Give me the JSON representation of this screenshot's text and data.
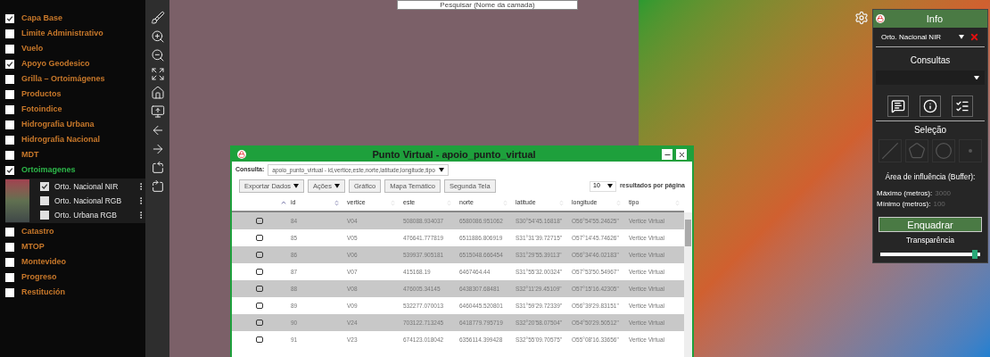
{
  "search": {
    "placeholder": "Pesquisar (Nome da camada)"
  },
  "layers": [
    {
      "label": "Capa Base",
      "checked": true,
      "expanded": false
    },
    {
      "label": "Limite Administrativo",
      "checked": false,
      "expanded": false
    },
    {
      "label": "Vuelo",
      "checked": false,
      "expanded": false
    },
    {
      "label": "Apoyo Geodesico",
      "checked": true,
      "expanded": false
    },
    {
      "label": "Grilla – Ortoimágenes",
      "checked": false,
      "expanded": false
    },
    {
      "label": "Productos",
      "checked": false,
      "expanded": false
    },
    {
      "label": "Fotoindice",
      "checked": false,
      "expanded": false
    },
    {
      "label": "Hidrografia Urbana",
      "checked": false,
      "expanded": false
    },
    {
      "label": "Hidrografia Nacional",
      "checked": false,
      "expanded": false
    },
    {
      "label": "MDT",
      "checked": false,
      "expanded": false
    },
    {
      "label": "Ortoimagenes",
      "checked": true,
      "expanded": true,
      "children": [
        {
          "label": "Orto. Nacional NIR",
          "checked": true
        },
        {
          "label": "Orto. Nacional RGB",
          "checked": false
        },
        {
          "label": "Orto. Urbana RGB",
          "checked": false
        }
      ]
    },
    {
      "label": "Catastro",
      "checked": false,
      "expanded": false
    },
    {
      "label": "MTOP",
      "checked": false,
      "expanded": false
    },
    {
      "label": "Montevideo",
      "checked": false,
      "expanded": false
    },
    {
      "label": "Progreso",
      "checked": false,
      "expanded": false
    },
    {
      "label": "Restitución",
      "checked": false,
      "expanded": false
    }
  ],
  "dialog": {
    "title": "Punto Virtual - apoio_punto_virtual",
    "query": {
      "label": "Consulta:",
      "value": "apoio_punto_virtual - id,vertice,este,norte,latitude,longitude,tipo"
    },
    "buttons": [
      {
        "label": "Exportar Dados",
        "dropdown": true
      },
      {
        "label": "Ações",
        "dropdown": true
      },
      {
        "label": "Gráfico",
        "dropdown": false
      },
      {
        "label": "Mapa Temático",
        "dropdown": false
      },
      {
        "label": "Segunda Tela",
        "dropdown": false
      }
    ],
    "page_size": {
      "value": "10",
      "label": "resultados por página"
    },
    "columns": [
      {
        "label": "id",
        "sorted": true
      },
      {
        "label": "vertice",
        "sorted": false
      },
      {
        "label": "este",
        "sorted": false
      },
      {
        "label": "norte",
        "sorted": false
      },
      {
        "label": "latitude",
        "sorted": false
      },
      {
        "label": "longitude",
        "sorted": false
      },
      {
        "label": "tipo",
        "sorted": false
      }
    ],
    "rows": [
      {
        "selected": false,
        "cells": [
          "84",
          "V04",
          "508088.934037",
          "6580086.951062",
          "S30°54'45.16818\"",
          "O56°54'55.24625\"",
          "Vertice Virtual"
        ]
      },
      {
        "selected": false,
        "cells": [
          "85",
          "V05",
          "476641.777819",
          "6511886.806919",
          "S31°31'39.72715\"",
          "O57°14'45.74626\"",
          "Vertice Virtual"
        ]
      },
      {
        "selected": false,
        "cells": [
          "86",
          "V06",
          "539937.905181",
          "6515048.666454",
          "S31°29'55.39113\"",
          "O56°34'46.02183\"",
          "Vertice Virtual"
        ]
      },
      {
        "selected": false,
        "cells": [
          "87",
          "V07",
          "415168.19",
          "6467464.44",
          "S31°55'32.00324\"",
          "O57°53'50.54967\"",
          "Vertice Virtual"
        ]
      },
      {
        "selected": false,
        "cells": [
          "88",
          "V08",
          "476005.34145",
          "6438307.68481",
          "S32°11'29.45109\"",
          "O57°15'16.42305\"",
          "Vertice Virtual"
        ]
      },
      {
        "selected": false,
        "cells": [
          "89",
          "V09",
          "532277.070013",
          "6460445.520801",
          "S31°59'29.72339\"",
          "O56°39'29.83151\"",
          "Vertice Virtual"
        ]
      },
      {
        "selected": false,
        "cells": [
          "90",
          "V24",
          "703122.713245",
          "6418779.795719",
          "S32°20'58.07504\"",
          "O54°50'29.50512\"",
          "Vertice Virtual"
        ]
      },
      {
        "selected": false,
        "cells": [
          "91",
          "V23",
          "674123.018042",
          "6356114.399428",
          "S32°55'09.70575\"",
          "O55°08'16.33656\"",
          "Vertice Virtual"
        ]
      }
    ]
  },
  "info": {
    "title": "Info",
    "layer_select": "Orto. Nacional NIR",
    "consultas": "Consultas",
    "selection": "Seleção",
    "buffer": "Área de influência (Buffer):",
    "fields": [
      {
        "label": "Máximo (metros):",
        "placeholder": "3000"
      },
      {
        "label": "Mínimo (metros):",
        "placeholder": "100"
      }
    ],
    "button": "Enquadrar",
    "transparency": {
      "label": "Transparência",
      "level": 0.95
    }
  }
}
